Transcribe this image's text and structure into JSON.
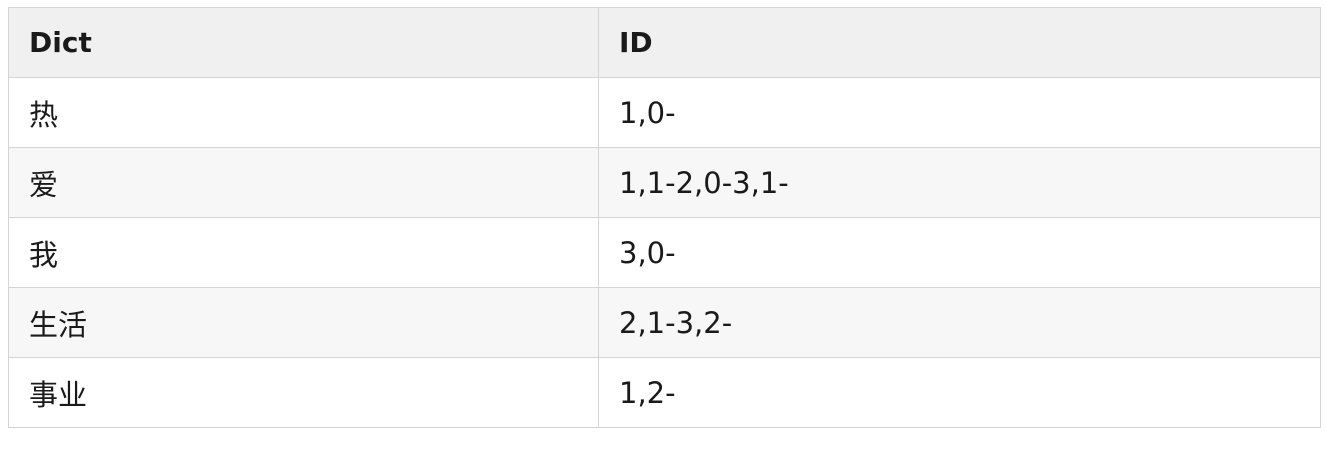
{
  "table": {
    "headers": [
      "Dict",
      "ID"
    ],
    "rows": [
      [
        "热",
        "1,0-"
      ],
      [
        "爱",
        "1,1-2,0-3,1-"
      ],
      [
        "我",
        "3,0-"
      ],
      [
        "生活",
        "2,1-3,2-"
      ],
      [
        "事业",
        "1,2-"
      ]
    ]
  }
}
